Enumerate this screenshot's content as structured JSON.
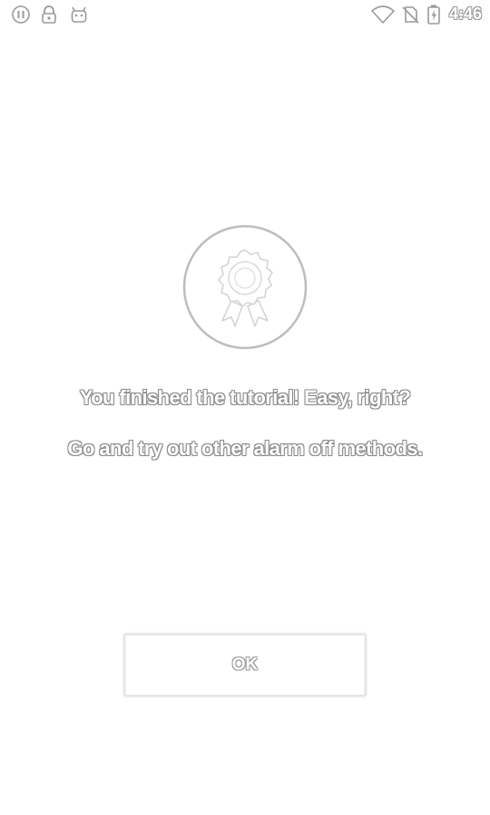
{
  "status_bar": {
    "time": "4:46",
    "left_icons": [
      "sync-icon",
      "lock-icon",
      "android-icon"
    ],
    "right_icons": [
      "wifi-icon",
      "no-sim-icon",
      "battery-charging-icon"
    ]
  },
  "badge": {
    "icon": "award-ribbon-icon"
  },
  "messages": {
    "line1": "You finished the tutorial! Easy, right?",
    "line2": "Go and try out other alarm off methods."
  },
  "ok_button": {
    "label": "OK"
  },
  "colors": {
    "background": "#ffffff",
    "text_fill": "#ffffff",
    "text_outline": "#8a8a8a"
  }
}
